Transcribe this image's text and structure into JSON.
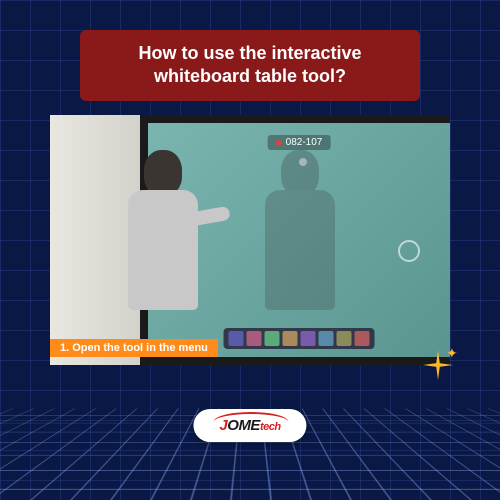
{
  "title": {
    "line1": "How to use the interactive",
    "line2": "whiteboard table tool?"
  },
  "video": {
    "indicator_text": "082-107",
    "caption": "1. Open the tool in the menu"
  },
  "toolbar": {
    "buttons": [
      {
        "name": "pointer",
        "color": "#5a5aaa"
      },
      {
        "name": "pen",
        "color": "#aa5a7a"
      },
      {
        "name": "eraser",
        "color": "#5aaa7a"
      },
      {
        "name": "shape",
        "color": "#aa8a5a"
      },
      {
        "name": "text",
        "color": "#7a5aaa"
      },
      {
        "name": "table",
        "color": "#5a8aaa"
      },
      {
        "name": "undo",
        "color": "#8a8a5a"
      },
      {
        "name": "more",
        "color": "#aa5a5a"
      }
    ]
  },
  "logo": {
    "part1": "J",
    "part2": "OME",
    "part3": "tech"
  }
}
